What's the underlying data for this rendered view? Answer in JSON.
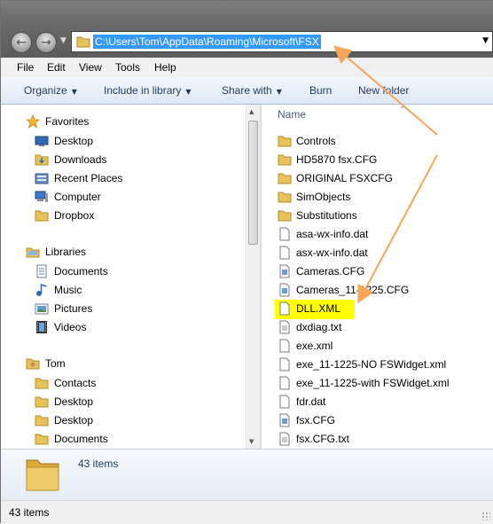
{
  "address": {
    "path": "C:\\Users\\Tom\\AppData\\Roaming\\Microsoft\\FSX"
  },
  "menu": {
    "items": [
      "File",
      "Edit",
      "View",
      "Tools",
      "Help"
    ]
  },
  "commands": {
    "organize": "Organize",
    "include_in_library": "Include in library",
    "share_with": "Share with",
    "burn": "Burn",
    "new_folder": "New folder"
  },
  "nav": {
    "favorites": {
      "label": "Favorites",
      "items": [
        "Desktop",
        "Downloads",
        "Recent Places",
        "Computer",
        "Dropbox"
      ]
    },
    "libraries": {
      "label": "Libraries",
      "items": [
        "Documents",
        "Music",
        "Pictures",
        "Videos"
      ]
    },
    "user": {
      "label": "Tom",
      "items": [
        "Contacts",
        "Desktop",
        "Desktop",
        "Documents"
      ]
    }
  },
  "files": {
    "column_name": "Name",
    "items": [
      {
        "name": "Controls",
        "type": "folder"
      },
      {
        "name": "HD5870 fsx.CFG",
        "type": "folder"
      },
      {
        "name": "ORIGINAL FSXCFG",
        "type": "folder"
      },
      {
        "name": "SimObjects",
        "type": "folder"
      },
      {
        "name": "Substitutions",
        "type": "folder"
      },
      {
        "name": "asa-wx-info.dat",
        "type": "file"
      },
      {
        "name": "asx-wx-info.dat",
        "type": "file"
      },
      {
        "name": "Cameras.CFG",
        "type": "config"
      },
      {
        "name": "Cameras_11-1225.CFG",
        "type": "config"
      },
      {
        "name": "DLL.XML",
        "type": "file",
        "highlighted": true
      },
      {
        "name": "dxdiag.txt",
        "type": "text"
      },
      {
        "name": "exe.xml",
        "type": "file"
      },
      {
        "name": "exe_11-1225-NO FSWidget.xml",
        "type": "file"
      },
      {
        "name": "exe_11-1225-with FSWidget.xml",
        "type": "file"
      },
      {
        "name": "fdr.dat",
        "type": "file"
      },
      {
        "name": "fsx.CFG",
        "type": "config"
      },
      {
        "name": "fsx.CFG.txt",
        "type": "text"
      }
    ]
  },
  "details": {
    "count": "43 items"
  },
  "status": {
    "text": "43 items"
  },
  "colors": {
    "selection": "#3399ff",
    "highlight": "#ffff00",
    "annotation_arrow": "#f5a656",
    "folder": "#e8c15a",
    "command_text": "#1e395b"
  }
}
